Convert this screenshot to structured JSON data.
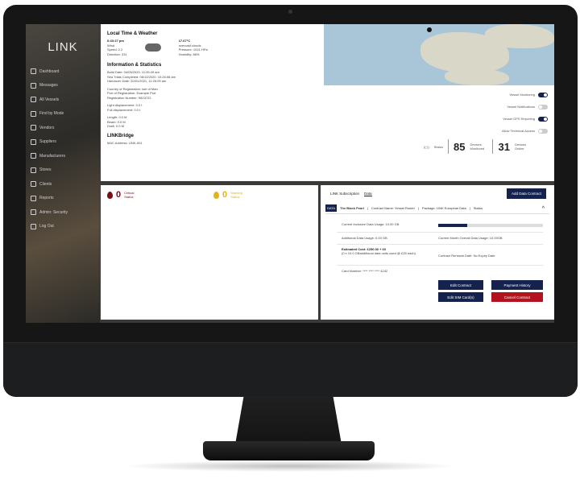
{
  "app": {
    "logo": "LINK"
  },
  "sidebar": {
    "items": [
      {
        "label": "Dashboard",
        "icon": "dashboard-icon"
      },
      {
        "label": "Messages",
        "icon": "messages-icon"
      },
      {
        "label": "All Vessels",
        "icon": "vessels-icon"
      },
      {
        "label": "Find by Mode",
        "icon": "search-icon"
      },
      {
        "label": "Vendors",
        "icon": "vendors-icon"
      },
      {
        "label": "Suppliers",
        "icon": "suppliers-icon"
      },
      {
        "label": "Manufacturers",
        "icon": "manufacturers-icon"
      },
      {
        "label": "Stores",
        "icon": "stores-icon"
      },
      {
        "label": "Clients",
        "icon": "clients-icon"
      },
      {
        "label": "Reports",
        "icon": "reports-icon"
      },
      {
        "label": "Admin: Security",
        "icon": "security-icon"
      },
      {
        "label": "Log Out",
        "icon": "logout-icon"
      }
    ]
  },
  "weather": {
    "title": "Local Time & Weather",
    "time": "6:43:27 pm",
    "wind": "Wind",
    "speed": "Speed: 2.2",
    "direction": "Direction: 331",
    "temp": "17.67°C",
    "condition": "overcast clouds",
    "pressure": "Pressure: 1021 HPa",
    "humidity": "Humidity: 86%"
  },
  "info": {
    "title": "Information & Statistics",
    "build_date": "Build Date: 04/05/2020, 11:35:49 am",
    "sea_trials": "Sea Trials Completed: 06/12/2020, 10:26:08 am",
    "handover": "Handover Date: 20/01/2021, 11:26:09 am",
    "country": "Country of Registration: Isle of Man",
    "port": "Port of Registration: Example Port",
    "reg_number": "Registration Number: 9823722",
    "light_disp": "Light displacement: 0.0 t",
    "full_disp": "Full displacement: 0.0 t",
    "length": "Length: 0.0 M",
    "beam": "Beam: 0.0 M",
    "draft": "Draft: 0.0 M"
  },
  "bridge": {
    "title": "LINKBridge",
    "mac": "MAC Address: LINK-001"
  },
  "toggles": [
    {
      "label": "Vessel Monitoring",
      "on": true
    },
    {
      "label": "Vessel Notifications",
      "on": false
    },
    {
      "label": "Vessel GPS Reporting",
      "on": true
    },
    {
      "label": "Allow Technical Access",
      "on": false
    }
  ],
  "stats": {
    "status_label": "Status",
    "status_value": "Status",
    "devices_monitored": "85",
    "devices_monitored_label": "Devices Monitored",
    "devices_online": "31",
    "devices_online_label": "Devices Online"
  },
  "alerts": {
    "critical_count": "0",
    "critical_label": "Critical Status",
    "warning_count": "0",
    "warning_label": "Warning Status",
    "critical_color": "#7a0d16",
    "warning_color": "#e3b21f"
  },
  "subscription": {
    "tab1": "LINK Subscription",
    "tab2": "Data",
    "add_button": "Add Data Contract",
    "vessel_tag": "DATA",
    "vessel_name": "The Black Pearl",
    "contract_name": "Contract Name: Vessel Router",
    "package": "Package: LINK European Data",
    "status": "Status",
    "usage_label": "Current Inclusive Data Usage: 10.00 GB",
    "usage_fraction": 0.28,
    "additional": "Additional Data Usage: 0.00 GB",
    "monthly": "Current Month Overall Data Usage: 10.00GB",
    "est_cost": "Estimated Cost: £250.00 + £0",
    "est_note": "(0 x 10.0 GBadditional data units used @ £25 each)",
    "renewal": "Contract Renewal Date: No Expiry Date",
    "card": "Card Number: **** **** **** 4242",
    "edit_contract": "Edit Contract",
    "payment_history": "Payment History",
    "edit_sim": "Edit SIM Card(s)",
    "cancel_contract": "Cancel Contract"
  }
}
